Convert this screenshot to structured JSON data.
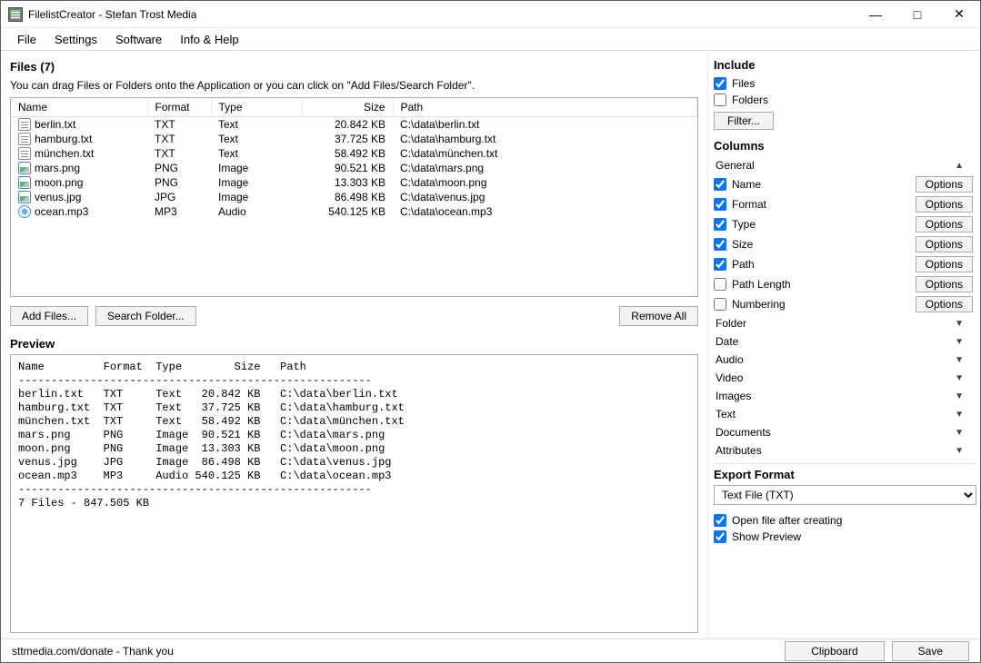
{
  "window": {
    "title": "FilelistCreator - Stefan Trost Media"
  },
  "menu": {
    "file": "File",
    "settings": "Settings",
    "software": "Software",
    "help": "Info & Help"
  },
  "files_section": {
    "title": "Files (7)",
    "hint": "You can drag Files or Folders onto the Application or you can click on \"Add Files/Search Folder\".",
    "headers": {
      "name": "Name",
      "format": "Format",
      "type": "Type",
      "size": "Size",
      "path": "Path"
    },
    "rows": [
      {
        "icon": "txt",
        "name": "berlin.txt",
        "format": "TXT",
        "type": "Text",
        "size": "20.842 KB",
        "path": "C:\\data\\berlin.txt"
      },
      {
        "icon": "txt",
        "name": "hamburg.txt",
        "format": "TXT",
        "type": "Text",
        "size": "37.725 KB",
        "path": "C:\\data\\hamburg.txt"
      },
      {
        "icon": "txt",
        "name": "münchen.txt",
        "format": "TXT",
        "type": "Text",
        "size": "58.492 KB",
        "path": "C:\\data\\münchen.txt"
      },
      {
        "icon": "img",
        "name": "mars.png",
        "format": "PNG",
        "type": "Image",
        "size": "90.521 KB",
        "path": "C:\\data\\mars.png"
      },
      {
        "icon": "img",
        "name": "moon.png",
        "format": "PNG",
        "type": "Image",
        "size": "13.303 KB",
        "path": "C:\\data\\moon.png"
      },
      {
        "icon": "img",
        "name": "venus.jpg",
        "format": "JPG",
        "type": "Image",
        "size": "86.498 KB",
        "path": "C:\\data\\venus.jpg"
      },
      {
        "icon": "aud",
        "name": "ocean.mp3",
        "format": "MP3",
        "type": "Audio",
        "size": "540.125 KB",
        "path": "C:\\data\\ocean.mp3"
      }
    ],
    "buttons": {
      "add": "Add Files...",
      "search": "Search Folder...",
      "remove": "Remove All"
    }
  },
  "preview": {
    "title": "Preview",
    "text": "Name         Format  Type        Size   Path\n------------------------------------------------------\nberlin.txt   TXT     Text   20.842 KB   C:\\data\\berlin.txt\nhamburg.txt  TXT     Text   37.725 KB   C:\\data\\hamburg.txt\nmünchen.txt  TXT     Text   58.492 KB   C:\\data\\münchen.txt\nmars.png     PNG     Image  90.521 KB   C:\\data\\mars.png\nmoon.png     PNG     Image  13.303 KB   C:\\data\\moon.png\nvenus.jpg    JPG     Image  86.498 KB   C:\\data\\venus.jpg\nocean.mp3    MP3     Audio 540.125 KB   C:\\data\\ocean.mp3\n------------------------------------------------------\n7 Files - 847.505 KB"
  },
  "include": {
    "title": "Include",
    "files": "Files",
    "folders": "Folders",
    "filter": "Filter...",
    "files_checked": true,
    "folders_checked": false
  },
  "columns": {
    "title": "Columns",
    "general": "General",
    "options": "Options",
    "items": [
      {
        "label": "Name",
        "checked": true
      },
      {
        "label": "Format",
        "checked": true
      },
      {
        "label": "Type",
        "checked": true
      },
      {
        "label": "Size",
        "checked": true
      },
      {
        "label": "Path",
        "checked": true
      },
      {
        "label": "Path Length",
        "checked": false
      },
      {
        "label": "Numbering",
        "checked": false
      }
    ],
    "groups": [
      "Folder",
      "Date",
      "Audio",
      "Video",
      "Images",
      "Text",
      "Documents",
      "Attributes"
    ]
  },
  "export": {
    "title": "Export Format",
    "value": "Text File (TXT)",
    "openafter": "Open file after creating",
    "openafter_checked": true,
    "showpreview": "Show Preview",
    "showpreview_checked": true
  },
  "status": {
    "text": "sttmedia.com/donate - Thank you",
    "clipboard": "Clipboard",
    "save": "Save"
  }
}
